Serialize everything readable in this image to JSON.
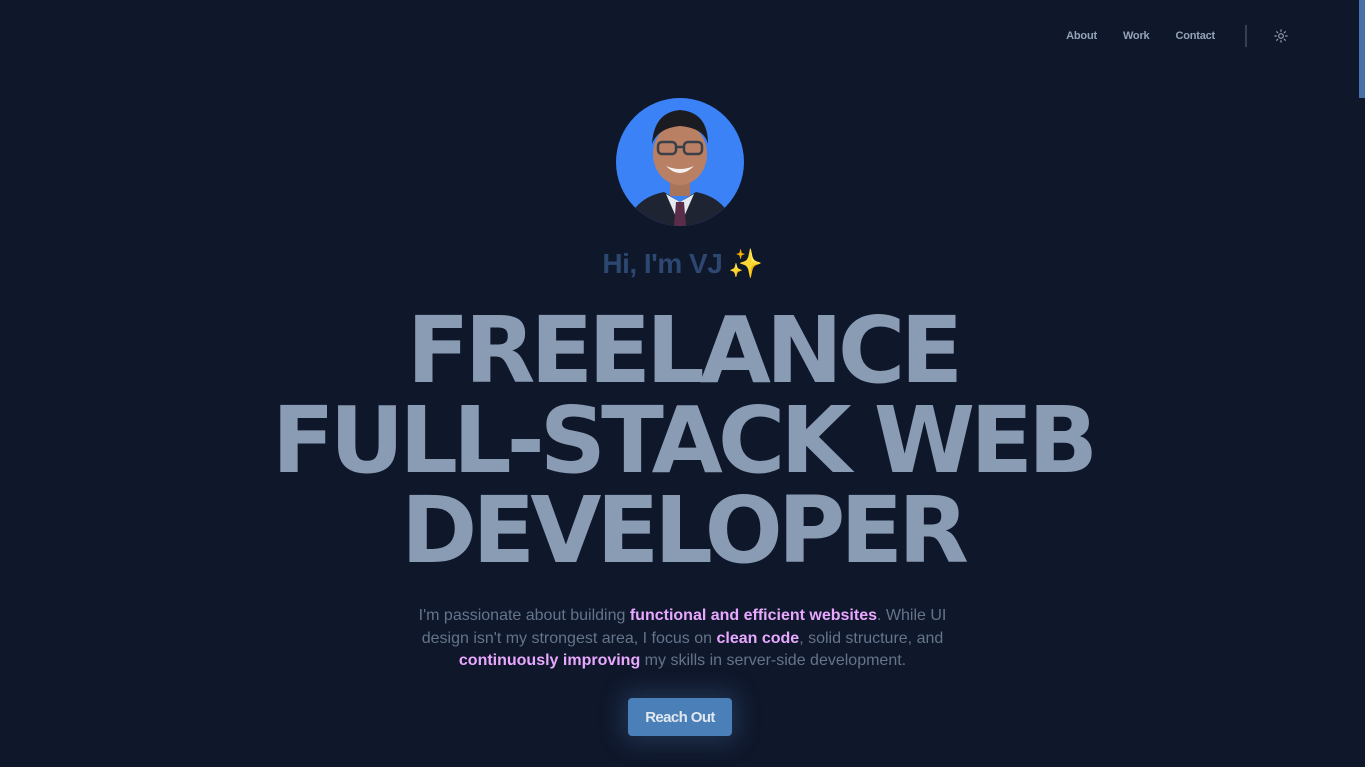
{
  "nav": {
    "items": [
      {
        "label": "About"
      },
      {
        "label": "Work"
      },
      {
        "label": "Contact"
      }
    ],
    "theme_toggle_icon": "sun-icon"
  },
  "hero": {
    "greeting": "Hi, I'm VJ",
    "greeting_emoji": "✨",
    "headline_lines": [
      "FREELANCE",
      "FULL-STACK WEB",
      "DEVELOPER"
    ],
    "tagline": {
      "p1": "I'm passionate about building ",
      "h1": "functional and efficient websites",
      "p2": ". While UI design isn't my strongest area, I focus on ",
      "h2": "clean code",
      "p3": ", solid structure, and ",
      "h3": "continuously improving",
      "p4": " my skills in server-side development."
    },
    "cta_label": "Reach Out"
  },
  "colors": {
    "background": "#0f172a",
    "accent": "#4a7fb8",
    "highlight": "#e9a8ff",
    "headline": "#8a9bb4"
  }
}
